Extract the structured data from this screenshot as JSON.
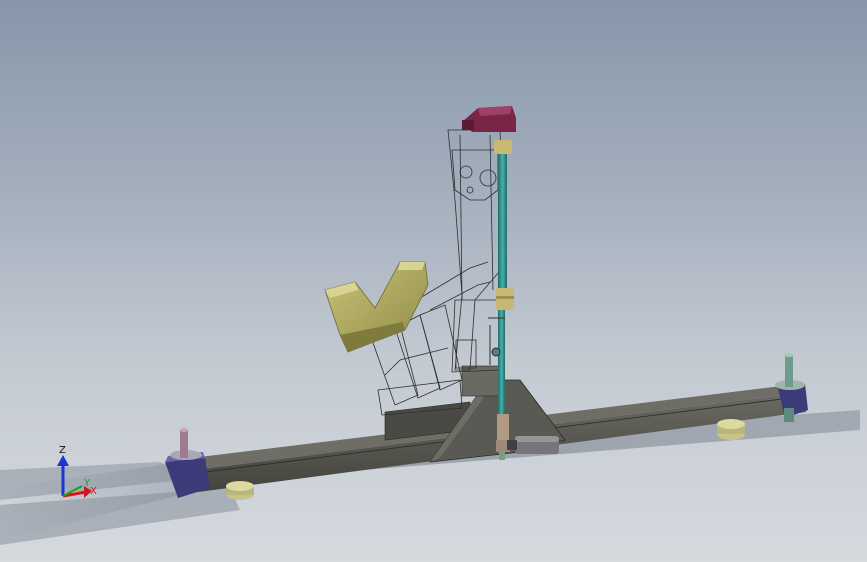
{
  "viewport": {
    "background_top": "#8796aa",
    "background_bottom": "#d6dadf"
  },
  "model": {
    "frame_color": "#4e4e48",
    "post_color": "#7a7d7a",
    "shaft_color": "#2f8a86",
    "clamp_color": "#7a2545",
    "cradle_color": "#a9a55a",
    "foot_color": "#c7c48a",
    "end_cap_color": "#3c3a78",
    "wireframe_color": "#2e2e2e"
  },
  "triad": {
    "z_label": "Z",
    "x_label": "X",
    "y_label": "Y",
    "x_color": "#d01818",
    "y_color": "#1aa31a",
    "z_color": "#1a36d0"
  }
}
